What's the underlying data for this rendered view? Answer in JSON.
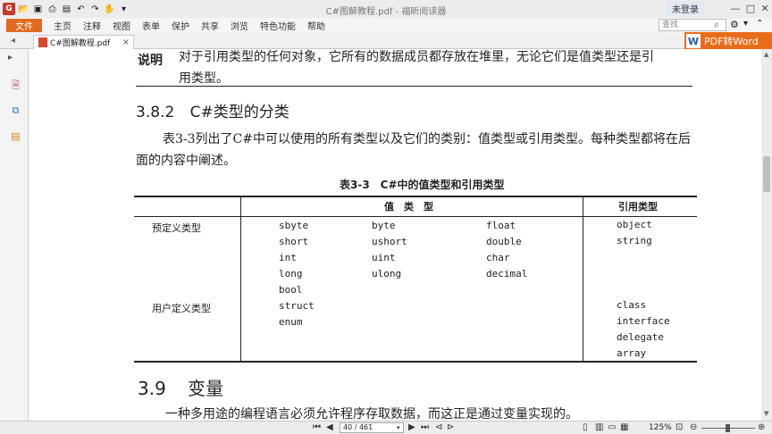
{
  "window": {
    "title": "C#图解教程.pdf - 福昕阅读器",
    "login_label": "未登录",
    "minimize": "—",
    "maximize": "□",
    "close": "✕"
  },
  "quick_access": [
    "open-icon",
    "save-icon",
    "print-icon",
    "undo-icon",
    "redo-icon",
    "hand-icon"
  ],
  "menu": {
    "file": "文件",
    "items": [
      "主页",
      "注释",
      "视图",
      "表单",
      "保护",
      "共享",
      "浏览",
      "特色功能",
      "帮助"
    ],
    "search_placeholder": "查找"
  },
  "tab": {
    "name": "C#图解教程.pdf",
    "close": "×"
  },
  "promo": {
    "icon_text": "W",
    "label": "PDF转Word"
  },
  "document": {
    "note_label": "说明",
    "note_lines": [
      "对于引用类型的任何对象，它所有的数据成员都存放在堆里，无论它们是值类型还是引",
      "用类型。"
    ],
    "section_number": "3.8.2",
    "section_title": "C#类型的分类",
    "paragraph": "表3-3列出了C#中可以使用的所有类型以及它们的类别：值类型或引用类型。每种类型都将在后面的内容中阐述。",
    "table_caption": "表3-3　C#中的值类型和引用类型",
    "table": {
      "header_value": "值　类　型",
      "header_ref": "引用类型",
      "row1_label": "预定义类型",
      "row2_label": "用户定义类型",
      "col1": [
        "sbyte",
        "short",
        "int",
        "long",
        "bool",
        "struct",
        "enum"
      ],
      "col2": [
        "byte",
        "ushort",
        "uint",
        "ulong"
      ],
      "col3": [
        "float",
        "double",
        "char",
        "decimal"
      ],
      "ref_predefined": [
        "object",
        "string"
      ],
      "ref_user": [
        "class",
        "interface",
        "delegate",
        "array"
      ]
    },
    "next_section_number": "3.9",
    "next_section_title": "变量",
    "bottom_text": "一种多用途的编程语言必须允许程序存取数据，而这正是通过变量实现的。"
  },
  "status": {
    "page": "40 / 461",
    "zoom": "125%"
  }
}
